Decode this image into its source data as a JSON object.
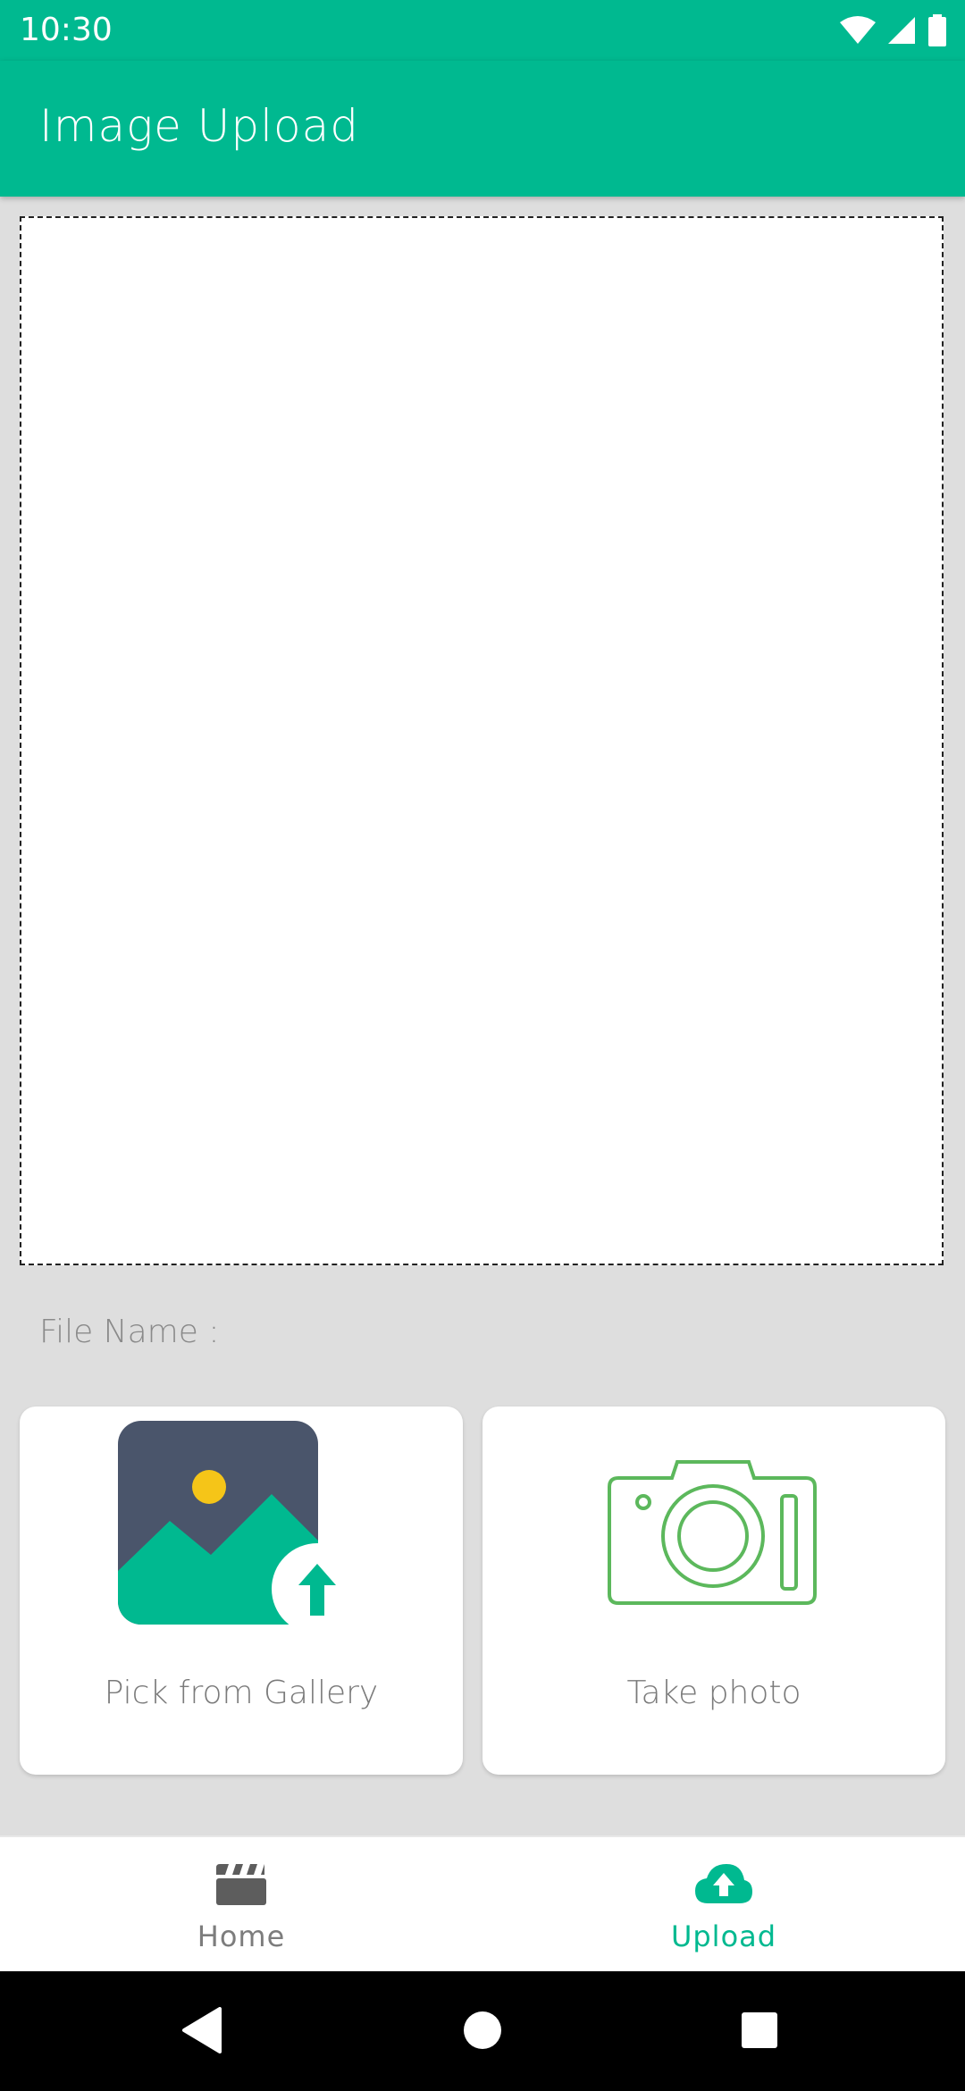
{
  "status_bar": {
    "time": "10:30",
    "icons": [
      "wifi-icon",
      "signal-icon",
      "battery-icon"
    ]
  },
  "app_bar": {
    "title": "Image Upload"
  },
  "form": {
    "file_name_label": "File Name :"
  },
  "actions": {
    "gallery_label": "Pick from Gallery",
    "camera_label": "Take photo"
  },
  "bottom_nav": {
    "items": [
      {
        "label": "Home",
        "icon": "clapperboard-icon",
        "selected": false
      },
      {
        "label": "Upload",
        "icon": "cloud-upload-icon",
        "selected": true
      }
    ]
  },
  "colors": {
    "primary": "#00b990",
    "background": "#dedede",
    "card": "#ffffff",
    "camera_stroke": "#5cb85c",
    "gallery_frame": "#4a556b",
    "sun": "#f5c518"
  }
}
